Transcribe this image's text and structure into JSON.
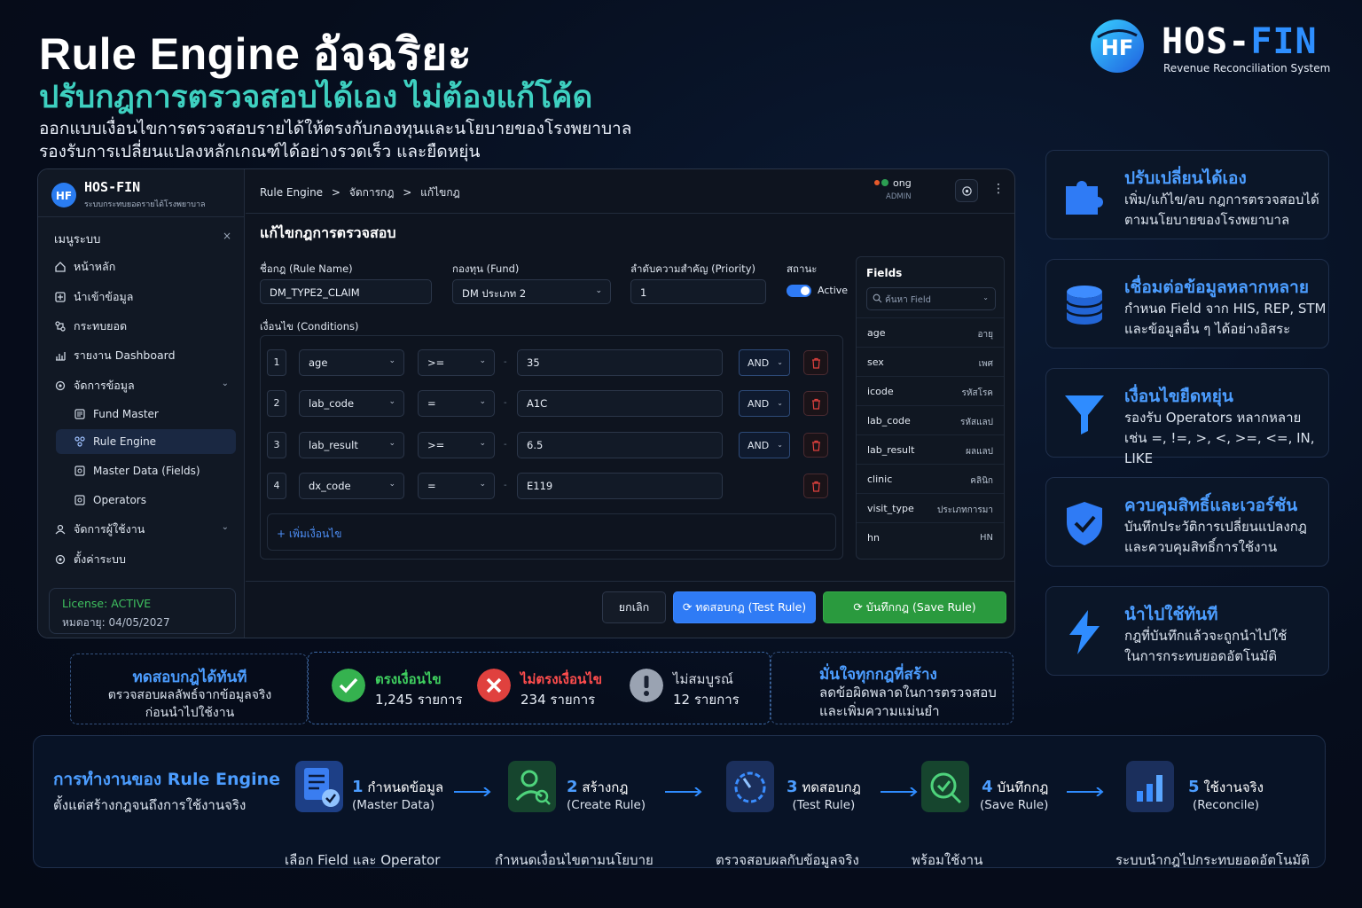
{
  "header": {
    "title": "Rule Engine อัจฉริยะ",
    "subtitle": "ปรับกฎการตรวจสอบได้เอง ไม่ต้องแก้โค้ด",
    "desc_1": "ออกแบบเงื่อนไขการตรวจสอบรายได้ให้ตรงกับกองทุนและนโยบายของโรงพยาบาล",
    "desc_2": "รองรับการเปลี่ยนแปลงหลักเกณฑ์ได้อย่างรวดเร็ว และยืดหยุ่น"
  },
  "brand": {
    "logo_text": "HF",
    "name_a": "HOS-",
    "name_b": "FIN",
    "tagline": "Revenue Reconciliation System"
  },
  "app": {
    "sidebar": {
      "name": "HOS-FIN",
      "tagline": "ระบบกระทบยอดรายได้โรงพยาบาล",
      "menu_title": "เมนูระบบ",
      "close": "×",
      "items": [
        {
          "label": "หน้าหลัก",
          "icon": "home-icon"
        },
        {
          "label": "นำเข้าข้อมูล",
          "icon": "import-icon"
        },
        {
          "label": "กระทบยอด",
          "icon": "reconcile-icon"
        },
        {
          "label": "รายงาน Dashboard",
          "icon": "chart-icon"
        },
        {
          "label": "จัดการข้อมูล",
          "icon": "settings-icon",
          "expanded": true
        },
        {
          "label": "Fund Master",
          "icon": "list-icon"
        },
        {
          "label": "Rule Engine",
          "icon": "rule-icon",
          "active": true
        },
        {
          "label": "Master Data (Fields)",
          "icon": "fields-icon"
        },
        {
          "label": "Operators",
          "icon": "operators-icon"
        },
        {
          "label": "จัดการผู้ใช้งาน",
          "icon": "user-icon"
        },
        {
          "label": "ตั้งค่าระบบ",
          "icon": "gear-icon"
        }
      ],
      "license_status": "License: ACTIVE",
      "license_expiry": "หมดอายุ: 04/05/2027"
    },
    "topbar": {
      "breadcrumb": [
        "Rule Engine",
        ">",
        "จัดการกฎ",
        ">",
        "แก้ไขกฎ"
      ],
      "user_name": "ong",
      "user_role": "ADMIN"
    },
    "form": {
      "page_title": "แก้ไขกฎการตรวจสอบ",
      "rule_name_label": "ชื่อกฎ (Rule Name)",
      "rule_name_value": "DM_TYPE2_CLAIM",
      "fund_label": "กองทุน (Fund)",
      "fund_value": "DM ประเภท 2",
      "priority_label": "ลำดับความสำคัญ (Priority)",
      "priority_value": "1",
      "status_label": "สถานะ",
      "status_value": "Active",
      "status_on": true,
      "conditions_label": "เงื่อนไข (Conditions)",
      "conditions": [
        {
          "no": "1",
          "field": "age",
          "op": ">=",
          "sep": "-",
          "value": "35",
          "logic": "AND"
        },
        {
          "no": "2",
          "field": "lab_code",
          "op": "=",
          "sep": "-",
          "value": "A1C",
          "logic": "AND"
        },
        {
          "no": "3",
          "field": "lab_result",
          "op": ">=",
          "sep": "-",
          "value": "6.5",
          "logic": "AND"
        },
        {
          "no": "4",
          "field": "dx_code",
          "op": "=",
          "sep": "-",
          "value": "E119",
          "logic": ""
        }
      ],
      "add_condition": "+ เพิ่มเงื่อนไข",
      "cancel": "ยกเลิก",
      "test": "ทดสอบกฎ (Test Rule)",
      "save": "บันทึกกฎ (Save Rule)"
    },
    "fields_panel": {
      "title": "Fields",
      "search_placeholder": "ค้นหา Field",
      "items": [
        {
          "name": "age",
          "desc": "อายุ"
        },
        {
          "name": "sex",
          "desc": "เพศ"
        },
        {
          "name": "icode",
          "desc": "รหัสโรค"
        },
        {
          "name": "lab_code",
          "desc": "รหัสแลป"
        },
        {
          "name": "lab_result",
          "desc": "ผลแลป"
        },
        {
          "name": "clinic",
          "desc": "คลินิก"
        },
        {
          "name": "visit_type",
          "desc": "ประเภทการมา"
        },
        {
          "name": "hn",
          "desc": "HN"
        }
      ]
    }
  },
  "features": [
    {
      "title": "ปรับเปลี่ยนได้เอง",
      "line1": "เพิ่ม/แก้ไข/ลบ กฎการตรวจสอบได้",
      "line2": "ตามนโยบายของโรงพยาบาล",
      "icon": "puzzle-icon"
    },
    {
      "title": "เชื่อมต่อข้อมูลหลากหลาย",
      "line1": "กำหนด Field จาก HIS, REP, STM",
      "line2": "และข้อมูลอื่น ๆ ได้อย่างอิสระ",
      "icon": "database-icon"
    },
    {
      "title": "เงื่อนไขยืดหยุ่น",
      "line1": "รองรับ Operators หลากหลาย",
      "line2": "เช่น =, !=, >, <, >=, <=, IN, LIKE",
      "icon": "funnel-icon"
    },
    {
      "title": "ควบคุมสิทธิ์และเวอร์ชัน",
      "line1": "บันทึกประวัติการเปลี่ยนแปลงกฎ",
      "line2": "และควบคุมสิทธิ์การใช้งาน",
      "icon": "shield-icon"
    },
    {
      "title": "นำไปใช้ทันที",
      "line1": "กฎที่บันทึกแล้วจะถูกนำไปใช้",
      "line2": "ในการกระทบยอดอัตโนมัติ",
      "icon": "lightning-icon"
    }
  ],
  "test_section": {
    "left_title": "ทดสอบกฎได้ทันที",
    "left_line1": "ตรวจสอบผลลัพธ์จากข้อมูลจริง",
    "left_line2": "ก่อนนำไปใช้งาน",
    "results": [
      {
        "label": "ตรงเงื่อนไข",
        "value": "1,245 รายการ",
        "color": "#35b24f",
        "text_color": "#3fcf5f",
        "icon": "check-icon"
      },
      {
        "label": "ไม่ตรงเงื่อนไข",
        "value": "234 รายการ",
        "color": "#e0413e",
        "text_color": "#ff4d4d",
        "icon": "x-icon"
      },
      {
        "label": "ไม่สมบูรณ์",
        "value": "12 รายการ",
        "color": "#9aa3b2",
        "text_color": "#d6dce6",
        "icon": "exclamation-icon"
      }
    ],
    "right_title": "มั่นใจทุกกฎที่สร้าง",
    "right_line1": "ลดข้อผิดพลาดในการตรวจสอบ",
    "right_line2": "และเพิ่มความแม่นยำ"
  },
  "workflow": {
    "title": "การทำงานของ Rule Engine",
    "subtitle": "ตั้งแต่สร้างกฎจนถึงการใช้งานจริง",
    "steps": [
      {
        "num": "1",
        "title": "กำหนดข้อมูล",
        "en": "(Master Data)",
        "caption": "เลือก Field และ Operator",
        "icon": "document-check-icon"
      },
      {
        "num": "2",
        "title": "สร้างกฎ",
        "en": "(Create Rule)",
        "caption": "กำหนดเงื่อนไขตามนโยบาย",
        "icon": "user-search-icon"
      },
      {
        "num": "3",
        "title": "ทดสอบกฎ",
        "en": "(Test Rule)",
        "caption": "ตรวจสอบผลกับข้อมูลจริง",
        "icon": "gauge-icon"
      },
      {
        "num": "4",
        "title": "บันทึกกฎ",
        "en": "(Save Rule)",
        "caption": "พร้อมใช้งาน",
        "icon": "shield-check-icon"
      },
      {
        "num": "5",
        "title": "ใช้งานจริง",
        "en": "(Reconcile)",
        "caption": "ระบบนำกฎไปกระทบยอดอัตโนมัติ",
        "icon": "bar-chart-icon"
      }
    ]
  }
}
